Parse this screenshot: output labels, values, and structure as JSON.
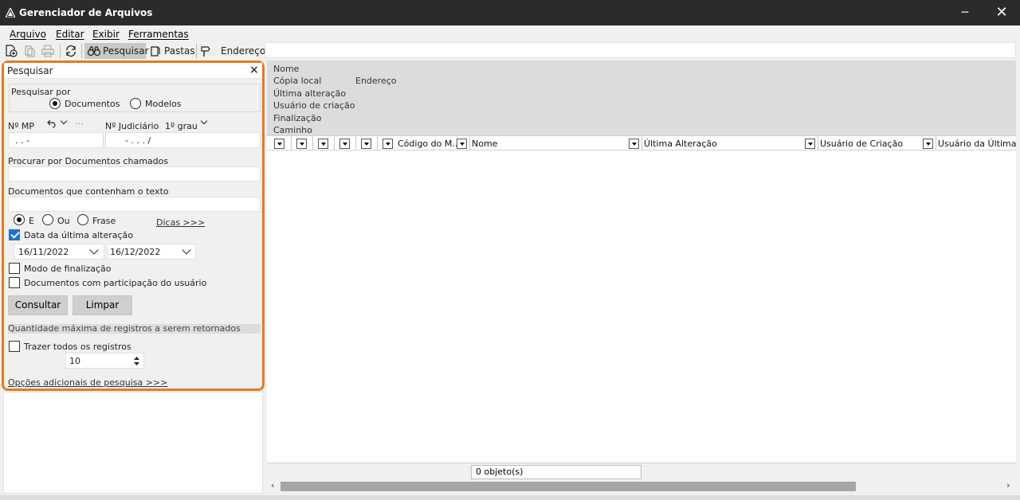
{
  "window": {
    "title": "Gerenciador de Arquivos",
    "minimize_glyph": "─",
    "close_glyph": "✕"
  },
  "menu": [
    "Arquivo",
    "Editar",
    "Exibir",
    "Ferramentas"
  ],
  "toolbar": {
    "pesquisar": "Pesquisar",
    "pastas": "Pastas",
    "endereco": "Endereço",
    "address_value": ""
  },
  "search": {
    "title": "Pesquisar",
    "close_glyph": "×",
    "pesquisar_por": "Pesquisar por",
    "opt_documentos": "Documentos",
    "opt_modelos": "Modelos",
    "nmp_label": "Nº MP",
    "nmp_extra": "···",
    "nmp_value": ".  .  -",
    "njud_label": "Nº Judiciário",
    "grau": "1º grau",
    "njud_value": "-  .  . .  /",
    "docs_chamados_label": "Procurar por Documentos chamados",
    "docs_chamados_value": "",
    "docs_texto_label": "Documentos que contenham o texto",
    "docs_texto_value": "",
    "opt_e": "E",
    "opt_ou": "Ou",
    "opt_frase": "Frase",
    "dicas": "Dicas >>>",
    "data_alteracao_label": "Data da última alteração",
    "date_from": "16/11/2022",
    "date_to": "16/12/2022",
    "modo_finalizacao": "Modo de finalização",
    "participacao": "Documentos com participação do usuário",
    "consultar": "Consultar",
    "limpar": "Limpar",
    "qtd_maxima": "Quantidade máxima de registros a serem retornados",
    "trazer_todos": "Trazer todos os registros",
    "max_value": "10",
    "opcoes_adicionais": "Opções adicionais de pesquisa >>>"
  },
  "details": {
    "nome": "Nome",
    "copia_local": "Cópia local",
    "endereco": "Endereço",
    "ultima_alteracao": "Última alteração",
    "usuario_criacao": "Usuário de criação",
    "finalizacao": "Finalização",
    "caminho": "Caminho"
  },
  "grid": {
    "col_codigo": "Código do M...",
    "col_nome": "Nome",
    "col_ultima": "Última Alteração",
    "col_usuario_criacao": "Usuário de Criação",
    "col_usuario_ultima": "Usuário da Última Alteração"
  },
  "status": {
    "count": "0 objeto(s)"
  },
  "scroll": {
    "left": "‹",
    "right": "›"
  }
}
